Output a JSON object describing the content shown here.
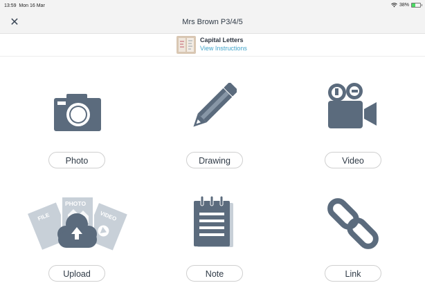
{
  "status_bar": {
    "time": "13:59",
    "date": "Mon 16 Mar",
    "battery_text": "38%",
    "battery_level": 0.38
  },
  "header": {
    "title": "Mrs Brown P3/4/5",
    "close_icon": "close-icon"
  },
  "task": {
    "name": "Capital Letters",
    "link_label": "View Instructions"
  },
  "options": [
    {
      "label": "Photo",
      "icon": "camera-icon"
    },
    {
      "label": "Drawing",
      "icon": "pencil-icon"
    },
    {
      "label": "Video",
      "icon": "video-camera-icon"
    },
    {
      "label": "Upload",
      "icon": "cloud-upload-icon"
    },
    {
      "label": "Note",
      "icon": "notepad-icon"
    },
    {
      "label": "Link",
      "icon": "chain-link-icon"
    }
  ],
  "upload_icon_labels": {
    "file": "FILE",
    "photo": "PHOTO",
    "video": "VIDEO"
  },
  "colors": {
    "icon": "#5b6b7d",
    "link": "#3fa3c9",
    "battery": "#4cd964",
    "upload_docs": "#c8d0d8"
  }
}
